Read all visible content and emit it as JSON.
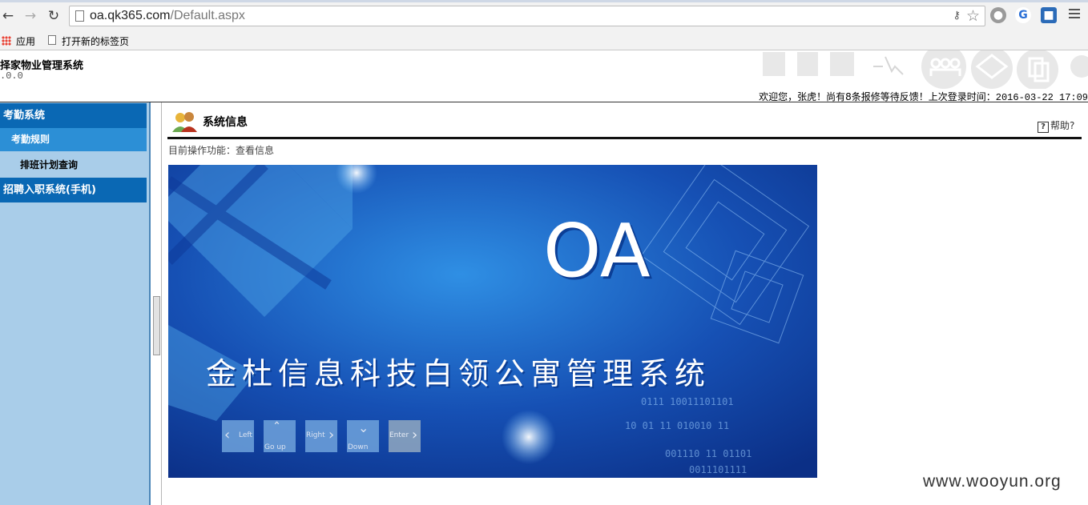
{
  "browser": {
    "url_host": "oa.qk365.com",
    "url_path": "/Default.aspx",
    "bookmarks": [
      "应用",
      "打开新的标签页"
    ]
  },
  "header": {
    "system_title": "择家物业管理系统",
    "version": ".0.0",
    "welcome_prefix": "欢迎您，张虎！尚有8条报修等待反馈！上次登录时间：",
    "last_login": "2016-03-22 17:09"
  },
  "sidebar": {
    "groups": [
      {
        "label": "考勤系统"
      },
      {
        "label": "招聘入职系统(手机)"
      }
    ],
    "sub_item": "考勤规则",
    "leaf_item": "排班计划查询"
  },
  "content": {
    "title": "系统信息",
    "help": "帮助?",
    "op_line": "目前操作功能：查看信息",
    "banner": {
      "logo": "OA",
      "headline": "金杜信息科技白领公寓管理系统",
      "keys": [
        "Left",
        "Go up",
        "Right",
        "Down",
        "Enter"
      ]
    }
  },
  "watermark": "www.wooyun.org",
  "colors": {
    "nav_group": "#0a68b4",
    "nav_sub": "#2c8fd6",
    "sidebar_bg": "#a9cde9",
    "banner_blue": "#1a4fb8"
  }
}
